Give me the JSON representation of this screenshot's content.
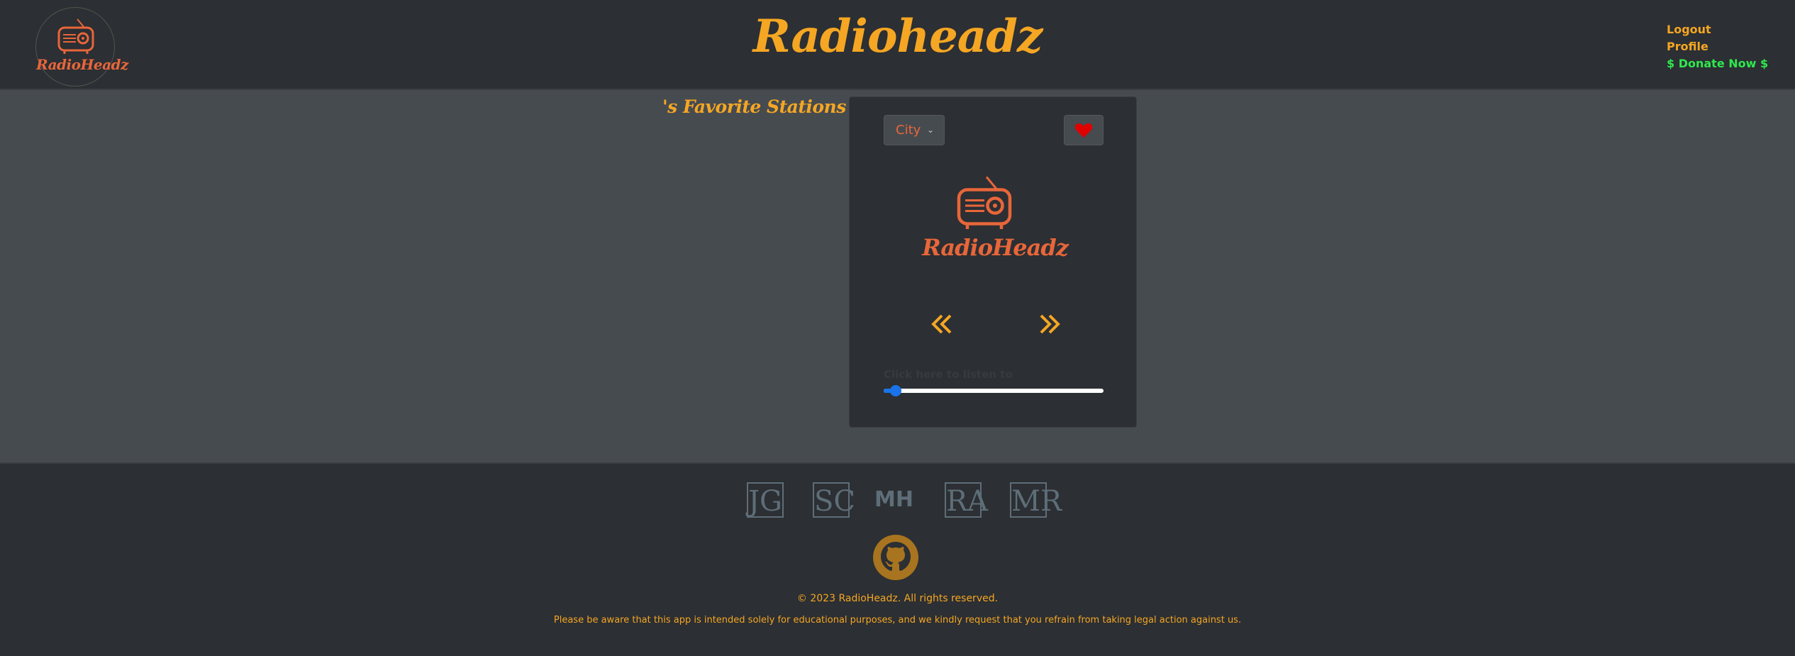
{
  "header": {
    "logo_text": "RadioHeadz",
    "title": "Radioheadz",
    "nav": {
      "logout": "Logout",
      "profile": "Profile",
      "donate": "$ Donate Now $"
    }
  },
  "main": {
    "favorites_title": "'s Favorite Stations"
  },
  "player": {
    "city_button": "City",
    "logo_text": "RadioHeadz",
    "listen_label": "Click here to listen to",
    "volume_level": 0.03
  },
  "footer": {
    "initials": [
      "JG",
      "SC",
      "MH",
      "RA",
      "MR"
    ],
    "copyright": "© 2023 RadioHeadz. All rights reserved.",
    "disclaimer": "Please be aware that this app is intended solely for educational purposes, and we kindly request that you refrain from taking legal action against us."
  },
  "icons": {
    "radio": "radio-icon",
    "heart": "heart-icon",
    "prev": "double-chevron-left-icon",
    "next": "double-chevron-right-icon",
    "github": "github-icon"
  },
  "colors": {
    "accent_orange": "#f5a623",
    "logo_red": "#e8663a",
    "donate_green": "#2ee84e",
    "heart_red": "#e00000",
    "slider_blue": "#1a73e8"
  }
}
